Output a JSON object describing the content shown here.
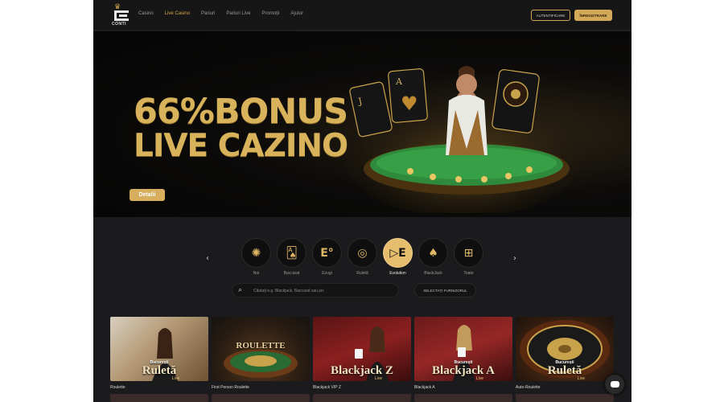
{
  "header": {
    "brand": "CONTI",
    "nav": [
      "Casino",
      "Live Casino",
      "Pariuri",
      "Pariuri Live",
      "Promoții",
      "Ajutor"
    ],
    "active_nav": "Live Casino",
    "login_label": "AUTENTIFICARE",
    "register_label": "ÎNREGISTRARE"
  },
  "hero": {
    "line1": "66%BONUS",
    "line2": "LIVE CAZINO",
    "cta": "Detalii"
  },
  "categories": [
    {
      "label": "Noi",
      "icon": "sun-chip-icon"
    },
    {
      "label": "Baccarat",
      "icon": "cards-icon"
    },
    {
      "label": "Ezugi",
      "icon": "ezugi-logo-icon"
    },
    {
      "label": "Ruletă",
      "icon": "roulette-icon"
    },
    {
      "label": "Evolution",
      "icon": "evolution-logo-icon",
      "active": true
    },
    {
      "label": "BlackJack",
      "icon": "blackjack-icon"
    },
    {
      "label": "Toate",
      "icon": "grid-icon"
    }
  ],
  "search": {
    "placeholder": "Căutați e.g. Blackjack, Baccarat sau joc",
    "provider_label": "SELECTAȚI FURNIZORUL"
  },
  "games": [
    {
      "name": "Roulette",
      "title": "Ruletă",
      "sub": "București",
      "live": "Live"
    },
    {
      "name": "First Person Roulette",
      "title": "ROULETTE",
      "sub": "",
      "live": ""
    },
    {
      "name": "Blackjack VIP Z",
      "title": "Blackjack Z",
      "sub": "",
      "live": "Live"
    },
    {
      "name": "Blackjack A",
      "title": "Blackjack A",
      "sub": "București",
      "live": "Live"
    },
    {
      "name": "Auto-Roulette",
      "title": "Ruletă",
      "sub": "București",
      "live": "Live"
    }
  ],
  "colors": {
    "accent": "#d8aa4a",
    "background": "#1b1b1d"
  }
}
